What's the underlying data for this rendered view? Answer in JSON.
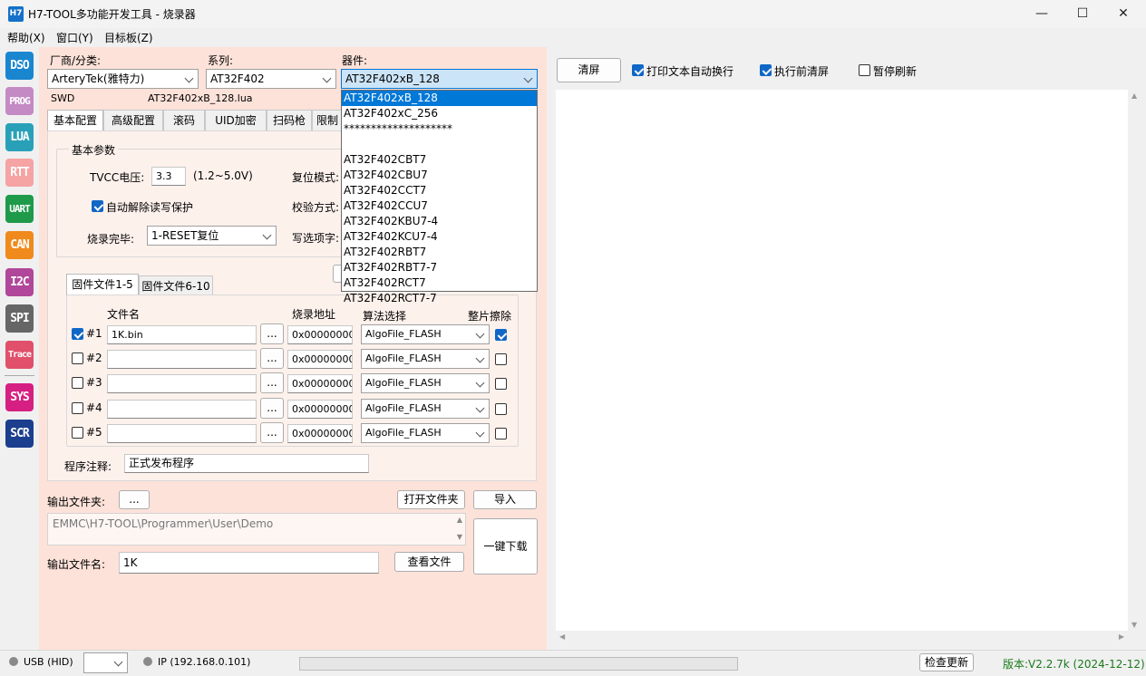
{
  "window": {
    "icon_text": "H7",
    "title": "H7-TOOL多功能开发工具 - 烧录器",
    "minimize": "—",
    "maximize": "☐",
    "close": "✕"
  },
  "menu": [
    "帮助(X)",
    "窗口(Y)",
    "目标板(Z)"
  ],
  "sidebar": [
    {
      "label": "DSO",
      "color": "#1a86d0"
    },
    {
      "label": "PROG",
      "color": "#c48ac4"
    },
    {
      "label": "LUA",
      "color": "#2aa0b8"
    },
    {
      "label": "RTT",
      "color": "#f5a3a3"
    },
    {
      "label": "UART",
      "color": "#1e9a4a"
    },
    {
      "label": "CAN",
      "color": "#f08a1c"
    },
    {
      "label": "I2C",
      "color": "#b0479a"
    },
    {
      "label": "SPI",
      "color": "#666666"
    },
    {
      "label": "Trace",
      "color": "#e0506a"
    },
    {
      "label": "SYS",
      "color": "#d61f82"
    },
    {
      "label": "SCR",
      "color": "#1b3f8e"
    }
  ],
  "device": {
    "vendor_label": "厂商/分类:",
    "vendor_value": "ArteryTek(雅特力)",
    "series_label": "系列:",
    "series_value": "AT32F402",
    "part_label": "器件:",
    "part_value": "AT32F402xB_128",
    "interface": "SWD",
    "lua_file": "AT32F402xB_128.lua"
  },
  "part_options": [
    "AT32F402xB_128",
    "AT32F402xC_256",
    "********************",
    "",
    "AT32F402CBT7",
    "AT32F402CBU7",
    "AT32F402CCT7",
    "AT32F402CCU7",
    "AT32F402KBU7-4",
    "AT32F402KCU7-4",
    "AT32F402RBT7",
    "AT32F402RBT7-7",
    "AT32F402RCT7",
    "AT32F402RCT7-7"
  ],
  "tabs": [
    "基本配置",
    "高级配置",
    "滚码",
    "UID加密",
    "扫码枪",
    "限制"
  ],
  "basic": {
    "group_title": "基本参数",
    "tvcc_label": "TVCC电压:",
    "tvcc_value": "3.3",
    "tvcc_range": "(1.2~5.0V)",
    "reset_mode_label": "复位模式:",
    "auto_unprotect_label": "自动解除读写保护",
    "auto_unprotect_checked": true,
    "verify_label": "校验方式:",
    "after_prog_label": "烧录完毕:",
    "after_prog_value": "1-RESET复位",
    "option_bytes_label": "写选项字:"
  },
  "file_tabs": [
    "固件文件1-5",
    "固件文件6-10"
  ],
  "file_table": {
    "headers": {
      "filename": "文件名",
      "address": "烧录地址",
      "algo": "算法选择",
      "erase": "整片擦除"
    },
    "browse": "...",
    "rows": [
      {
        "enabled": true,
        "num": "#1",
        "file": "1K.bin",
        "address": "0x00000000",
        "algo": "AlgoFile_FLASH",
        "erase": true
      },
      {
        "enabled": false,
        "num": "#2",
        "file": "",
        "address": "0x00000000",
        "algo": "AlgoFile_FLASH",
        "erase": false
      },
      {
        "enabled": false,
        "num": "#3",
        "file": "",
        "address": "0x00000000",
        "algo": "AlgoFile_FLASH",
        "erase": false
      },
      {
        "enabled": false,
        "num": "#4",
        "file": "",
        "address": "0x00000000",
        "algo": "AlgoFile_FLASH",
        "erase": false
      },
      {
        "enabled": false,
        "num": "#5",
        "file": "",
        "address": "0x00000000",
        "algo": "AlgoFile_FLASH",
        "erase": false
      }
    ]
  },
  "note": {
    "label": "程序注释:",
    "value": "正式发布程序"
  },
  "output": {
    "folder_label": "输出文件夹:",
    "folder_browse": "...",
    "open_folder": "打开文件夹",
    "import": "导入",
    "path": "EMMC\\H7-TOOL\\Programmer\\User\\Demo",
    "one_click": "一键下载",
    "name_label": "输出文件名:",
    "name_value": "1K",
    "view_file": "查看文件"
  },
  "console": {
    "clear": "清屏",
    "wrap_label": "打印文本自动换行",
    "wrap_checked": true,
    "clear_before_label": "执行前清屏",
    "clear_before_checked": true,
    "pause_label": "暂停刷新",
    "pause_checked": false
  },
  "status": {
    "usb": "USB (HID)",
    "ip": "IP (192.168.0.101)",
    "check_update": "检查更新",
    "version": "版本:V2.2.7k (2024-12-12)",
    "version_color": "#1a7a1a"
  }
}
